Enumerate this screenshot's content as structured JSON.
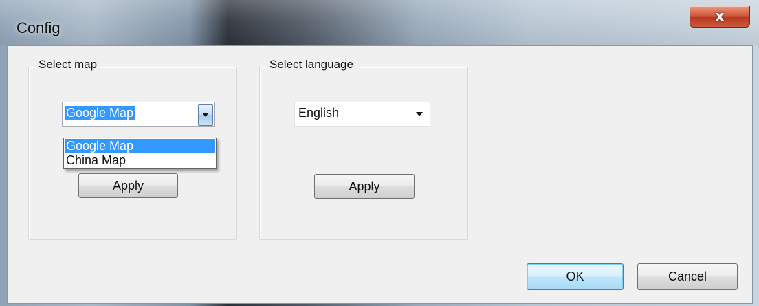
{
  "window": {
    "title": "Config",
    "close_glyph": "x"
  },
  "map_group": {
    "legend": "Select map",
    "combo_value": "Google Map",
    "options": [
      "Google Map",
      "China Map"
    ],
    "highlighted_option": "Google Map",
    "apply_label": "Apply"
  },
  "language_group": {
    "legend": "Select language",
    "combo_value": "English",
    "apply_label": "Apply"
  },
  "footer": {
    "ok_label": "OK",
    "cancel_label": "Cancel"
  },
  "colors": {
    "selection": "#3399ff",
    "close_button": "#c8452b",
    "client_bg": "#f0f0f0"
  },
  "icons": {
    "close": "close-icon",
    "combo_arrow": "chevron-down-icon"
  }
}
